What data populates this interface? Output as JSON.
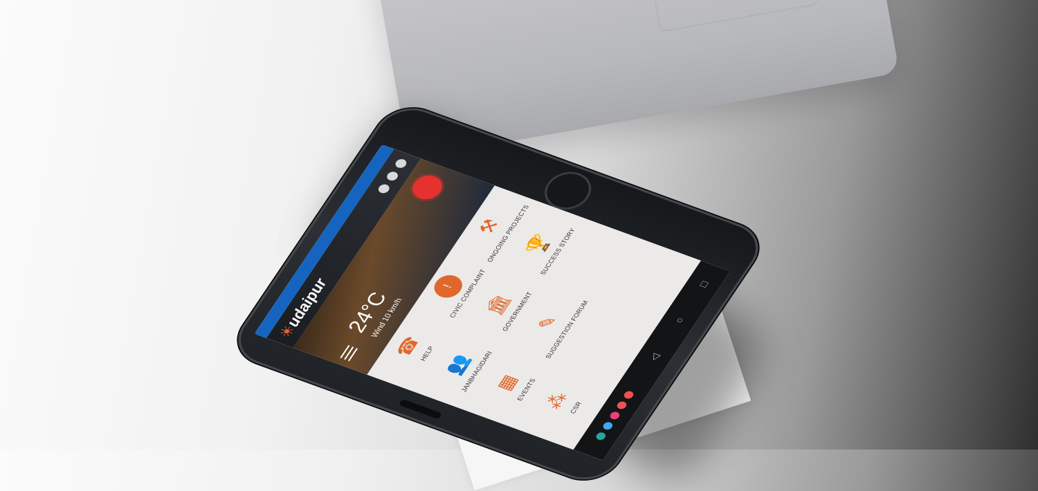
{
  "app": {
    "logo_text": "udaipur",
    "weather": {
      "temperature": "24°C",
      "wind": "Wind 10 km/h"
    }
  },
  "tiles": [
    {
      "label": "HELP",
      "icon": "phone-help-icon"
    },
    {
      "label": "CIVIC COMPLAINT",
      "icon": "complaint-icon"
    },
    {
      "label": "ONGOING PROJECTS",
      "icon": "worker-icon"
    },
    {
      "label": "JANBHAGIDARI",
      "icon": "people-icon"
    },
    {
      "label": "GOVERNMENT",
      "icon": "government-building-icon"
    },
    {
      "label": "SUCCESS STORY",
      "icon": "trophy-icon"
    },
    {
      "label": "EVENTS",
      "icon": "calendar-icon"
    },
    {
      "label": "SUGGESTION FORUM",
      "icon": "note-pencil-icon"
    },
    {
      "label": ""
    },
    {
      "label": "CSR",
      "icon": "csr-icon"
    }
  ],
  "colors": {
    "accent": "#e0672c",
    "statusbar": "#1565c0",
    "badge": "#e5322f",
    "social_dots": [
      "#26a69a",
      "#42a5f5",
      "#ec407a",
      "#ef5350",
      "#ef5350"
    ]
  }
}
